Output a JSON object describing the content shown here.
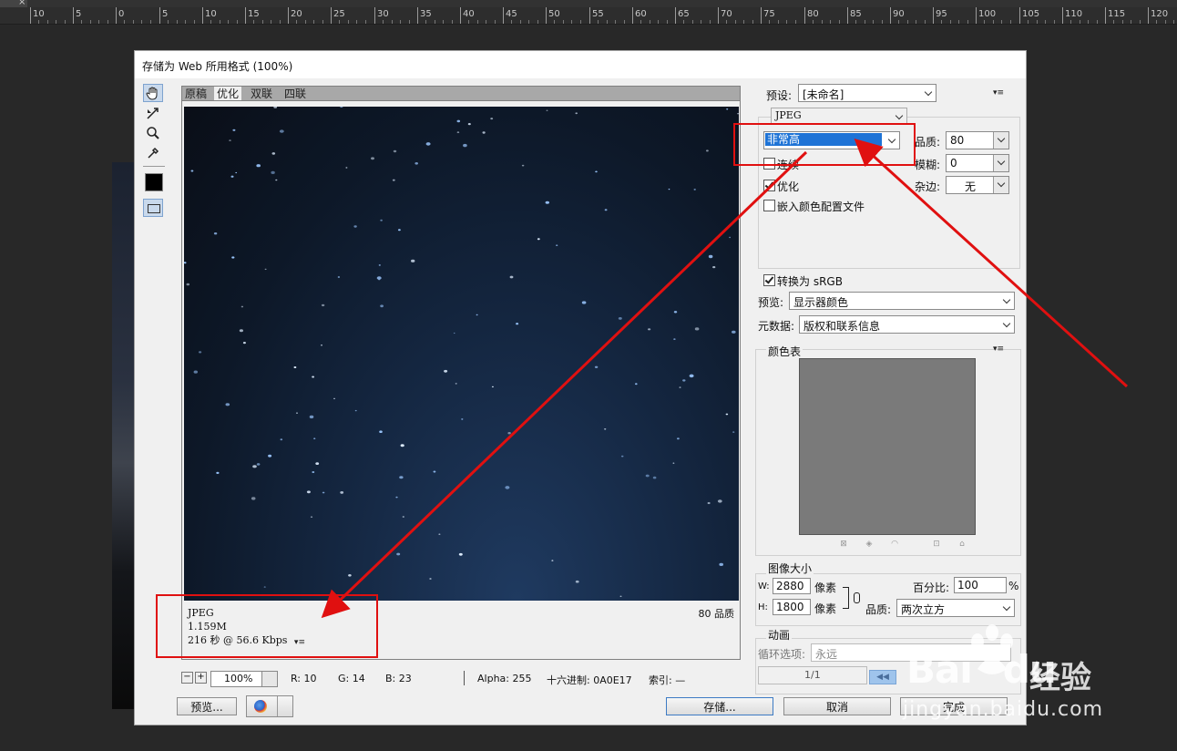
{
  "ruler": {
    "tab_close": "×",
    "labels": [
      "10",
      "5",
      "0",
      "5",
      "10",
      "15",
      "20",
      "25",
      "30",
      "35",
      "40",
      "45",
      "50",
      "55",
      "60",
      "65",
      "70",
      "75",
      "80",
      "85",
      "90",
      "95",
      "100",
      "105",
      "110",
      "115",
      "120"
    ]
  },
  "dialog": {
    "title": "存储为 Web 所用格式 (100%)",
    "tabs": [
      "原稿",
      "优化",
      "双联",
      "四联"
    ],
    "preview_info": {
      "format": "JPEG",
      "size": "1.159M",
      "time": "216 秒 @ 56.6 Kbps",
      "quality_label": "80 品质"
    },
    "status": {
      "zoom_minus": "−",
      "zoom_plus": "+",
      "zoom_value": "100%",
      "r": "R: 10",
      "g": "G: 14",
      "b": "B: 23",
      "alpha": "Alpha: 255",
      "hex": "十六进制: 0A0E17",
      "index": "索引: —"
    },
    "buttons": {
      "preview": "预览...",
      "save": "存储...",
      "cancel": "取消",
      "done": "完成"
    }
  },
  "settings": {
    "preset_label": "预设:",
    "preset_value": "[未命名]",
    "format_value": "JPEG",
    "quality_preset": "非常高",
    "quality_label": "品质:",
    "quality_value": "80",
    "progressive_label": "连续",
    "progressive_checked": false,
    "blur_label": "模糊:",
    "blur_value": "0",
    "optimized_label": "优化",
    "optimized_checked": true,
    "matte_label": "杂边:",
    "matte_value": "无",
    "embed_profile_label": "嵌入颜色配置文件",
    "embed_profile_checked": false,
    "convert_srgb_label": "转换为 sRGB",
    "convert_srgb_checked": true,
    "preview_label": "预览:",
    "preview_value": "显示器颜色",
    "metadata_label": "元数据:",
    "metadata_value": "版权和联系信息",
    "color_table_label": "颜色表",
    "image_size_label": "图像大小",
    "width_label": "W:",
    "width_value": "2880",
    "height_label": "H:",
    "height_value": "1800",
    "pixels_unit": "像素",
    "percent_label": "百分比:",
    "percent_value": "100",
    "percent_unit": "%",
    "resample_label": "品质:",
    "resample_value": "两次立方",
    "animation_label": "动画",
    "loop_label": "循环选项:",
    "loop_value": "永远",
    "frame_counter": "1/1"
  },
  "watermark": {
    "logo": "Bai",
    "logo_suffix": "du",
    "name": "经验",
    "url": "jingyan.baidu.com"
  },
  "colors": {
    "annotation_red": "#e01010",
    "selection_blue": "#1e73d6",
    "default_button_border": "#3d7bc4"
  }
}
